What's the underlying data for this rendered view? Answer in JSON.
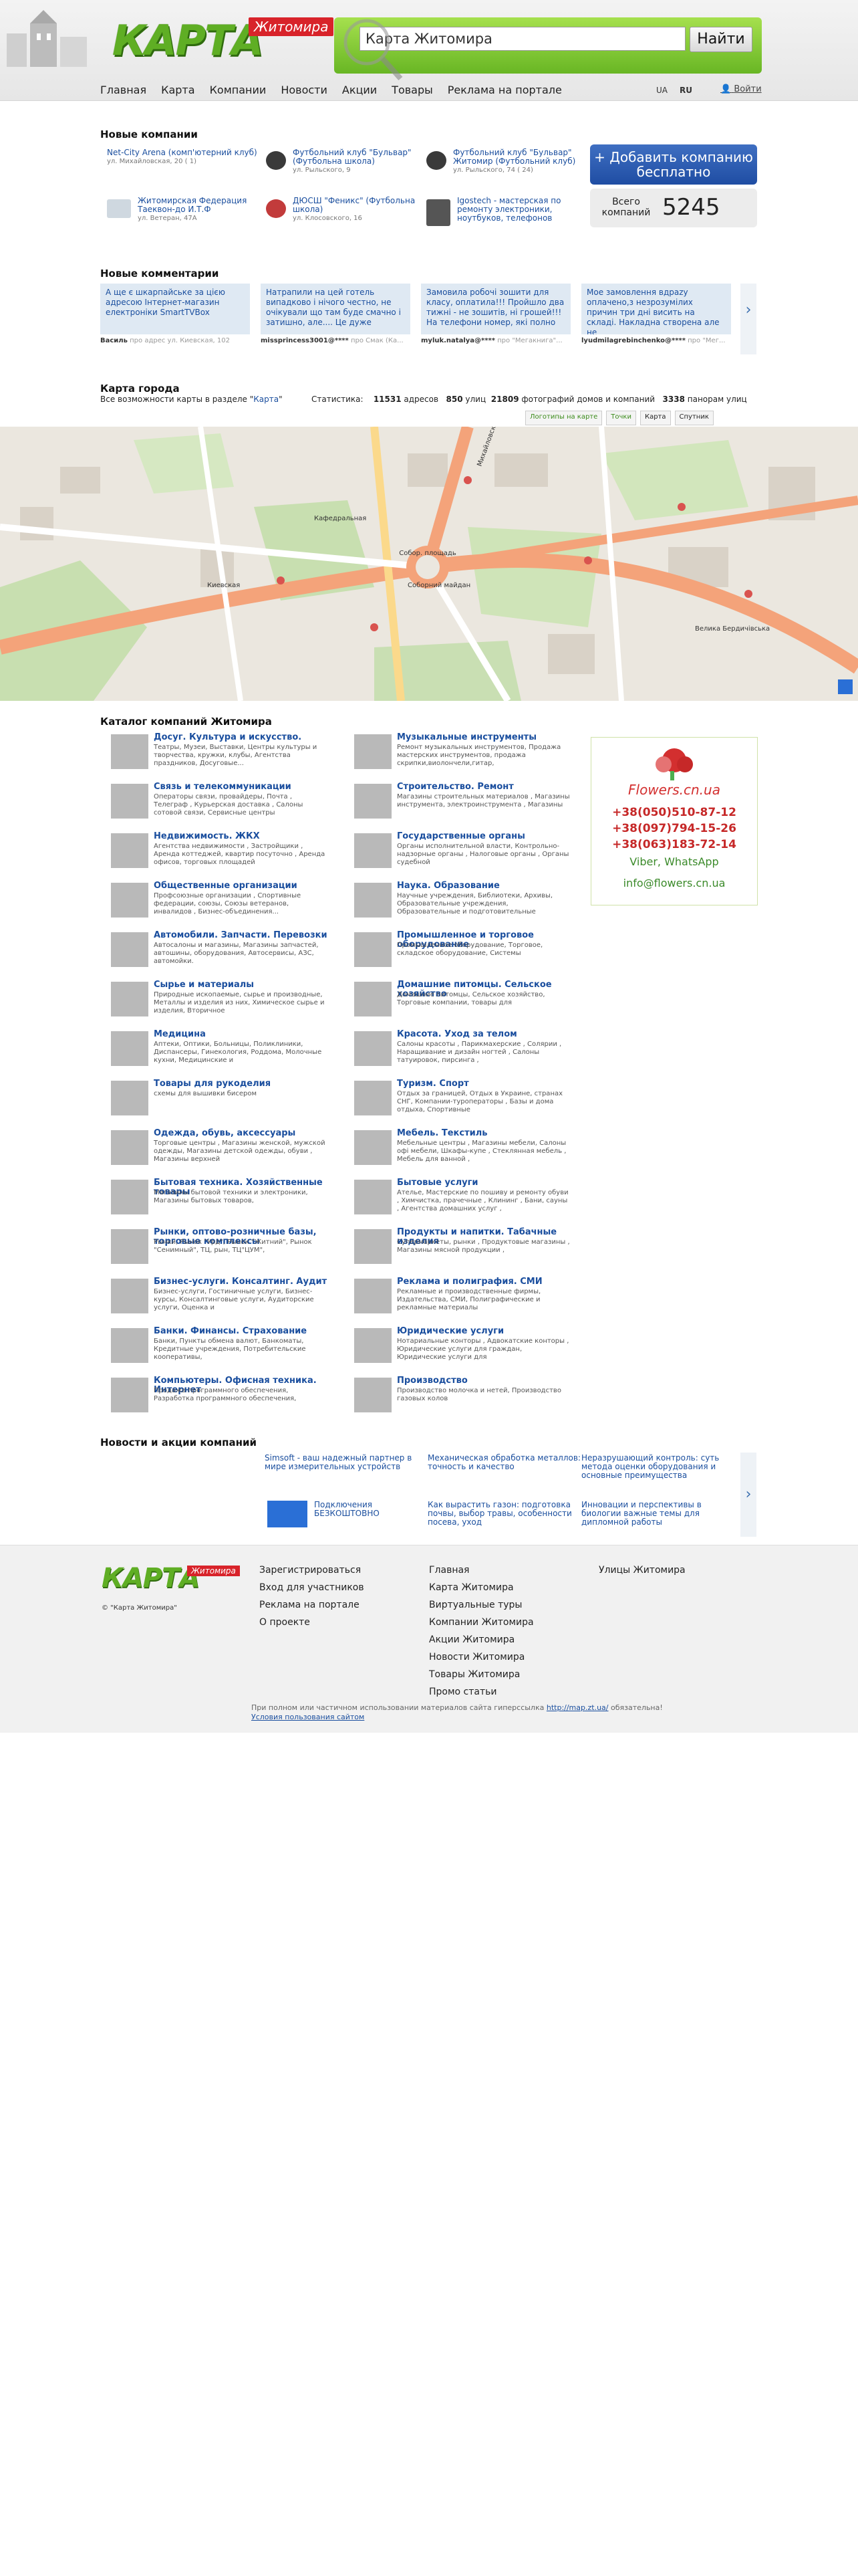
{
  "header": {
    "logo_text": "КАРТА",
    "logo_city": "Житомира",
    "search_value": "Карта Житомира",
    "search_button": "Найти",
    "nav": [
      "Главная",
      "Карта",
      "Компании",
      "Новости",
      "Акции",
      "Товары",
      "Реклама на портале"
    ],
    "lang_ua": "UA",
    "lang_ru": "RU",
    "login": "Войти"
  },
  "new_companies": {
    "title": "Новые компании",
    "items": [
      {
        "name": "Net-City Arena (комп'ютерний клуб)",
        "address": "ул. Михайловская, 20 ( 1)"
      },
      {
        "name": "Футбольний клуб \"Бульвар\" (Футбольна школа)",
        "address": "ул. Рыльского, 9"
      },
      {
        "name": "Футбольний клуб \"Бульвар\" Житомир (Футбольний клуб)",
        "address": "ул. Рыльского, 74 ( 24)"
      },
      {
        "name": "Житомирская Федерация Таеквон-до И.Т.Ф",
        "address": "ул. Ветеран, 47А"
      },
      {
        "name": "ДЮСШ \"Феникс\" (Футбольна школа)",
        "address": "ул. Клосовского, 16"
      },
      {
        "name": "Igostech - мастерская по ремонту электроники, ноутбуков, телефонов",
        "address": ""
      }
    ],
    "add_button": "+ Добавить компанию бесплатно",
    "total_label": "Всего компаний",
    "total_count": "5245"
  },
  "comments": {
    "title": "Новые комментарии",
    "items": [
      {
        "text": "А ще є шкарпайське за цією адресою Інтернет-магазин електроніки SmartTVBox",
        "author": "Василь",
        "where": "про адрес ул. Киевская, 102"
      },
      {
        "text": "Натрапили на цей готель випадково і нічого честно, не очікували що там буде смачно і затишно, але.... Це дуже",
        "author": "missprincess3001@****",
        "where": "про Смак (Ка..."
      },
      {
        "text": "Замовила робочі зошити для класу, оплатила!!! Пройшло два тижні - не зошитів, ні грошей!!! На телефони номер, які полно",
        "author": "myluk.natalya@****",
        "where": "про \"Мегакнига\"..."
      },
      {
        "text": "Мое замовлення вдрazу оплачено,з незрозумілих причин три дні висить на складі. Накладна створена але не",
        "author": "lyudmilagrebinchenko@****",
        "where": "про \"Мег..."
      }
    ]
  },
  "map_section": {
    "title": "Карта города",
    "sub_prefix": "Все возможности карты в разделе \"",
    "sub_link": "Карта",
    "sub_suffix": "\"",
    "stats_label": "Статистика:",
    "addresses_count": "11531",
    "addresses_label": "адресов",
    "streets_count": "850",
    "streets_label": "улиц",
    "photos_count": "21809",
    "photos_label": "фотографий домов и компаний",
    "panoramas_count": "3338",
    "panoramas_label": "панорам улиц",
    "tabs": [
      "Логотипы на карте",
      "Точки",
      "Карта",
      "Спутник"
    ],
    "labels": [
      "Собор. площадь",
      "Кафедральная",
      "Михайловская",
      "Киевская",
      "Велика Бердичівська",
      "Соборний майдан"
    ]
  },
  "catalog": {
    "title": "Каталог компаний Житомира",
    "left": [
      {
        "name": "Досуг. Культура и искусство.",
        "desc": "Театры, Музеи, Выставки, Центры культуры и творчества, кружки, клубы, Агентства праздников, Досуговые..."
      },
      {
        "name": "Связь и телекоммуникации",
        "desc": "Операторы связи, провайдеры, Почта , Телеграф , Курьерская доставка , Салоны сотовой связи, Сервисные центры"
      },
      {
        "name": "Недвижимость. ЖКХ",
        "desc": "Агентства недвижимости , Застройщики , Аренда коттеджей, квартир посуточно , Аренда офисов, торговых площадей"
      },
      {
        "name": "Общественные организации",
        "desc": "Профсоюзные организации , Спортивные федерации, союзы, Союзы ветеранов, инвалидов , Бизнес-объединения..."
      },
      {
        "name": "Автомобили. Запчасти. Перевозки",
        "desc": "Автосалоны и магазины, Магазины запчастей, автошины, оборудования, Автосервисы, АЗС, автомойки."
      },
      {
        "name": "Сырье и материалы",
        "desc": "Природные ископаемые, сырье и производные, Металлы и изделия из них, Химическое сырье и изделия, Вторичное"
      },
      {
        "name": "Медицина",
        "desc": "Аптеки, Оптики, Больницы, Поликлиники, Диспансеры, Гинекология, Роддома, Молочные кухни, Медицинские и"
      },
      {
        "name": "Товары для рукоделия",
        "desc": "схемы для вышивки бисером"
      },
      {
        "name": "Одежда, обувь, аксессуары",
        "desc": "Торговые центры , Магазины женской, мужской одежды, Магазины детской одежды, обуви , Магазины верхней"
      },
      {
        "name": "Бытовая техника. Хозяйственные товары",
        "desc": "Магазины бытовой техники и электроники, Магазины бытовых товаров,"
      },
      {
        "name": "Рынки, оптово-розничные базы, торговые комплексы",
        "desc": "Рынки, Рынок \"Урд\", Рынок \"Житний\", Рынок \"Сенимный\", ТЦ, рын, ТЦ\"ЦУМ\","
      },
      {
        "name": "Бизнес-услуги. Консалтинг. Аудит",
        "desc": "Бизнес-услуги, Гостиничные услуги, Бизнес-курсы, Консалтинговые услуги, Аудиторские услуги, Оценка и"
      },
      {
        "name": "Банки. Финансы. Страхование",
        "desc": "Банки, Пункты обмена валют, Банкоматы, Кредитные учреждения, Потребительские кооперативы,"
      },
      {
        "name": "Компьютеры. Офисная техника. Интернет",
        "desc": "Продажа программного обеспечения, Разработка программного обеспечения,"
      }
    ],
    "right": [
      {
        "name": "Музыкальные инструменты",
        "desc": "Ремонт музыкальных инструментов, Продажа мастерских инструментов, продажа скрипки,виолончели,гитар,"
      },
      {
        "name": "Строительство. Ремонт",
        "desc": "Магазины строительных материалов , Магазины инструмента, электроинструмента , Магазины"
      },
      {
        "name": "Государственные органы",
        "desc": "Органы исполнительной власти, Контрольно-надзорные органы , Налоговые органы , Органы судебной"
      },
      {
        "name": "Наука. Образование",
        "desc": "Научные учреждения, Библиотеки, Архивы, Образовательные учреждения, Образовательные и подготовительные"
      },
      {
        "name": "Промышленное и торговое оборудование",
        "desc": "Промышленное оборудование, Торговое, складское оборудование, Системы"
      },
      {
        "name": "Домашние питомцы. Сельское хозяйство",
        "desc": "Домашние питомцы, Сельское хозяйство, Торговые компании, товары для"
      },
      {
        "name": "Красота. Уход за телом",
        "desc": "Салоны красоты , Парикмахерские , Солярии , Наращивание и дизайн ногтей , Салоны татуировок, пирсинга ,"
      },
      {
        "name": "Туризм. Спорт",
        "desc": "Отдых за границей, Отдых в Украине, странах СНГ, Компании-туроператоры , Базы и дома отдыха, Спортивные"
      },
      {
        "name": "Мебель. Текстиль",
        "desc": "Мебельные центры , Магазины мебели, Салоны офі мебели, Шкафы-купе , Стеклянная мебель , Мебель для ванной ,"
      },
      {
        "name": "Бытовые услуги",
        "desc": "Ателье, Мастерские по пошиву и ремонту обуви , Химчистка, прачечные , Клининг , Бани, сауны , Агентства домашних услуг ,"
      },
      {
        "name": "Продукты и напитки. Табачные изделия",
        "desc": "Супермаркеты, рынки , Продуктовые магазины , Магазины мясной продукции ,"
      },
      {
        "name": "Реклама и полиграфия. СМИ",
        "desc": "Рекламные и производственные фирмы, Издательства, СМИ, Полиграфические и рекламные материалы"
      },
      {
        "name": "Юридические услуги",
        "desc": "Нотариальные конторы , Адвокатские конторы , Юридические услуги для граждан, Юридические услуги для"
      },
      {
        "name": "Производство",
        "desc": "Производство  молочка и нетей, Производство газовых колов"
      }
    ]
  },
  "ad": {
    "brand": "Flowers.cn.ua",
    "phones": [
      "+38(050)510-87-12",
      "+38(097)794-15-26",
      "+38(063)183-72-14"
    ],
    "messengers": "Viber, WhatsApp",
    "email": "info@flowers.cn.ua"
  },
  "news": {
    "title": "Новости и акции компаний",
    "items": [
      {
        "text": "Simsoft - ваш надежный партнер в мире измерительных устройств"
      },
      {
        "text": "Механическая обработка металлов: точность и качество"
      },
      {
        "text": "Неразрушающий контроль: суть метода оценки оборудования и основные преимущества"
      },
      {
        "text": "Подключения БЕЗКОШТОВНО"
      },
      {
        "text": "Как вырастить газон: подготовка почвы, выбор травы, особенности посева, уход"
      },
      {
        "text": "Инновации и перспективы в биологии важные темы для дипломной работы"
      }
    ]
  },
  "footer": {
    "copyright": "© \"Карта Житомира\"",
    "col1": [
      "Зарегистрироваться",
      "Вход для участников",
      "Реклама на портале",
      "О проекте"
    ],
    "col2": [
      "Главная",
      "Карта Житомира",
      "Виртуальные туры",
      "Компании Житомира",
      "Акции Житомира",
      "Новости Житомира",
      "Товары Житомира",
      "Промо статьи"
    ],
    "col3": [
      "Улицы Житомира"
    ],
    "note_prefix": "При полном или частичном использовании материалов сайта гиперссылка ",
    "note_link": "http://map.zt.ua/",
    "note_suffix": " обязательна!",
    "terms": "Условия пользования сайтом"
  }
}
